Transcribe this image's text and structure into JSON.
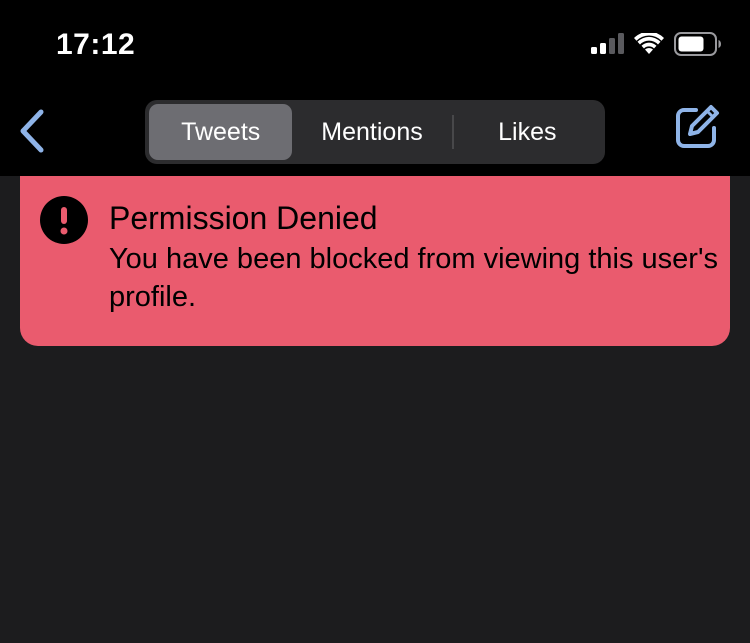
{
  "status_bar": {
    "time": "17:12",
    "icons": [
      "cellular-signal-icon",
      "wifi-icon",
      "battery-icon"
    ]
  },
  "nav": {
    "back_icon": "chevron-left-icon",
    "tabs": [
      {
        "label": "Tweets",
        "selected": true
      },
      {
        "label": "Mentions",
        "selected": false
      },
      {
        "label": "Likes",
        "selected": false
      }
    ],
    "compose_icon": "compose-icon"
  },
  "error": {
    "icon": "exclamation-circle-icon",
    "title": "Permission Denied",
    "message": "You have been blocked from viewing this user's profile."
  },
  "colors": {
    "accent": "#8fb4e8",
    "error_background": "#ea5b6e",
    "content_background": "#1c1c1e",
    "bar_background": "#000000"
  }
}
